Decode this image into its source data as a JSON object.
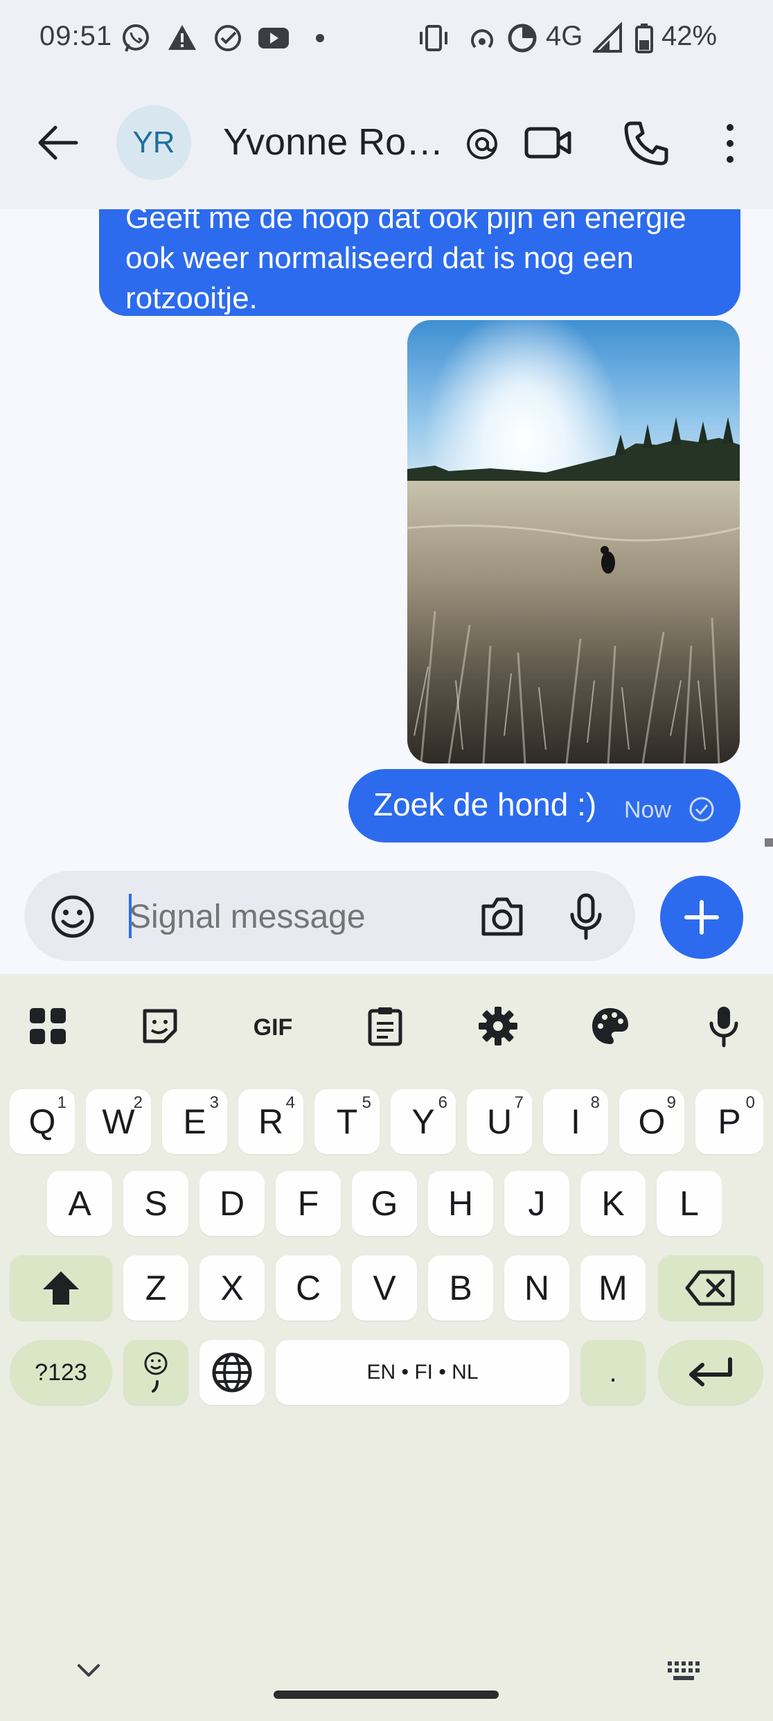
{
  "status_bar": {
    "time": "09:51",
    "network": "4G",
    "battery": "42%",
    "icons": [
      "whatsapp-icon",
      "warning-icon",
      "check-circle-icon",
      "youtube-icon",
      "dot-icon",
      "vibrate-icon",
      "hotspot-icon",
      "data-saver-icon",
      "signal-icon",
      "battery-icon"
    ]
  },
  "header": {
    "avatar_initials": "YR",
    "contact_name": "Yvonne Rosi…",
    "icons": [
      "back-arrow-icon",
      "mention-icon",
      "video-call-icon",
      "phone-icon",
      "more-vert-icon"
    ]
  },
  "messages": [
    {
      "direction": "outgoing",
      "type": "text",
      "text": "Geeft me de hoop dat ook pijn en energie ook weer normaliseerd dat is nog een rotzooitje."
    },
    {
      "direction": "outgoing",
      "type": "image"
    },
    {
      "direction": "outgoing",
      "type": "text",
      "text": "Zoek de hond :)",
      "time": "Now",
      "status": "sent"
    }
  ],
  "compose": {
    "placeholder": "Signal message",
    "icons": [
      "emoji-icon",
      "camera-icon",
      "mic-icon",
      "plus-icon"
    ]
  },
  "keyboard": {
    "toolbar_icons": [
      "apps-grid-icon",
      "sticker-icon",
      "gif-icon",
      "clipboard-icon",
      "settings-gear-icon",
      "palette-icon",
      "mic-icon"
    ],
    "row1": [
      {
        "k": "Q",
        "s": "1"
      },
      {
        "k": "W",
        "s": "2"
      },
      {
        "k": "E",
        "s": "3"
      },
      {
        "k": "R",
        "s": "4"
      },
      {
        "k": "T",
        "s": "5"
      },
      {
        "k": "Y",
        "s": "6"
      },
      {
        "k": "U",
        "s": "7"
      },
      {
        "k": "I",
        "s": "8"
      },
      {
        "k": "O",
        "s": "9"
      },
      {
        "k": "P",
        "s": "0"
      }
    ],
    "row2": [
      "A",
      "S",
      "D",
      "F",
      "G",
      "H",
      "J",
      "K",
      "L"
    ],
    "row3": [
      "Z",
      "X",
      "C",
      "V",
      "B",
      "N",
      "M"
    ],
    "symbols_label": "?123",
    "space_label": "EN • FI • NL",
    "period_label": ".",
    "colors": {
      "accent": "#2c6bed",
      "key": "#fefefe",
      "alt_key": "#dbe6c7",
      "keyboard_bg": "#ebede3"
    }
  }
}
